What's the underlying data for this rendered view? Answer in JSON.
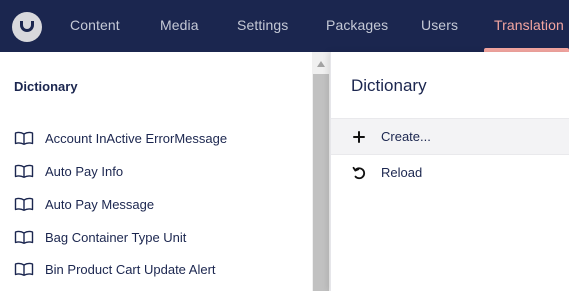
{
  "nav": {
    "items": [
      {
        "label": "Content"
      },
      {
        "label": "Media"
      },
      {
        "label": "Settings"
      },
      {
        "label": "Packages"
      },
      {
        "label": "Users"
      },
      {
        "label": "Translation"
      }
    ],
    "active_color": "#f3a5a0",
    "background": "#1b264f"
  },
  "tree": {
    "title": "Dictionary",
    "items": [
      {
        "label": "Account InActive ErrorMessage",
        "icon": "book-icon"
      },
      {
        "label": "Auto Pay Info",
        "icon": "book-icon"
      },
      {
        "label": "Auto Pay Message",
        "icon": "book-icon"
      },
      {
        "label": "Bag Container Type Unit",
        "icon": "book-icon"
      },
      {
        "label": "Bin Product Cart Update Alert",
        "icon": "book-icon"
      }
    ]
  },
  "menu": {
    "title": "Dictionary",
    "items": [
      {
        "label": "Create...",
        "icon": "plus-icon"
      },
      {
        "label": "Reload",
        "icon": "reload-icon"
      }
    ]
  }
}
